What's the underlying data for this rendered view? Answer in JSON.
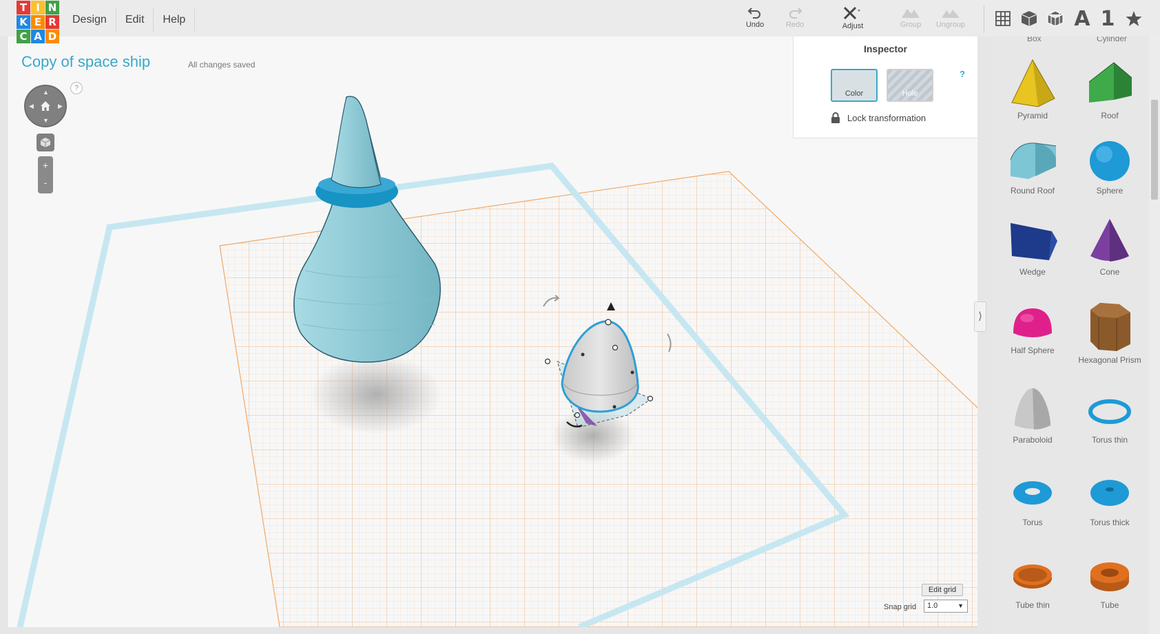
{
  "logo": {
    "letters": [
      "T",
      "I",
      "N",
      "K",
      "E",
      "R",
      "C",
      "A",
      "D"
    ],
    "colors": [
      "#e53935",
      "#fbc02d",
      "#43a047",
      "#1e88e5",
      "#fb8c00",
      "#e53935",
      "#43a047",
      "#1e88e5",
      "#fb8c00"
    ]
  },
  "menu": {
    "items": [
      "Design",
      "Edit",
      "Help"
    ]
  },
  "toolbar": {
    "undo": {
      "label": "Undo",
      "icon": "undo-icon"
    },
    "redo": {
      "label": "Redo",
      "icon": "redo-icon"
    },
    "adjust": {
      "label": "Adjust",
      "icon": "adjust-icon"
    },
    "group": {
      "label": "Group",
      "icon": "group-icon"
    },
    "ungroup": {
      "label": "Ungroup",
      "icon": "ungroup-icon"
    }
  },
  "views": {
    "grid": "grid-view-icon",
    "box": "box-view-icon",
    "wireframe": "wireframe-view-icon",
    "text_label": "A",
    "number_label": "1",
    "star": "star-icon"
  },
  "document": {
    "title": "Copy of space ship",
    "status": "All changes saved"
  },
  "nav": {
    "help": "?",
    "zoom_in": "+",
    "zoom_out": "-"
  },
  "inspector": {
    "title": "Inspector",
    "help": "?",
    "color_label": "Color",
    "hole_label": "Hole",
    "lock_label": "Lock transformation",
    "color_value": "#d9e0e4"
  },
  "grid": {
    "edit_label": "Edit grid",
    "snap_label": "Snap grid",
    "snap_value": "1.0"
  },
  "panel": {
    "cut_left": "Box",
    "cut_right": "Cylinder",
    "collapse": "⟩",
    "shapes": [
      {
        "name": "Pyramid",
        "icon": "pyramid-icon",
        "color": "#e8c520"
      },
      {
        "name": "Roof",
        "icon": "roof-icon",
        "color": "#3faa4a"
      },
      {
        "name": "Round Roof",
        "icon": "round-roof-icon",
        "color": "#7cc6d6"
      },
      {
        "name": "Sphere",
        "icon": "sphere-icon",
        "color": "#1e9ad6"
      },
      {
        "name": "Wedge",
        "icon": "wedge-icon",
        "color": "#1e3a8a"
      },
      {
        "name": "Cone",
        "icon": "cone-icon",
        "color": "#7b3fa0"
      },
      {
        "name": "Half Sphere",
        "icon": "half-sphere-icon",
        "color": "#e0208a"
      },
      {
        "name": "Hexagonal Prism",
        "icon": "hexagonal-prism-icon",
        "color": "#8b5a2b"
      },
      {
        "name": "Paraboloid",
        "icon": "paraboloid-icon",
        "color": "#c8c8c8"
      },
      {
        "name": "Torus thin",
        "icon": "torus-thin-icon",
        "color": "#1e9ad6"
      },
      {
        "name": "Torus",
        "icon": "torus-icon",
        "color": "#1e9ad6"
      },
      {
        "name": "Torus thick",
        "icon": "torus-thick-icon",
        "color": "#1e9ad6"
      },
      {
        "name": "Tube thin",
        "icon": "tube-thin-icon",
        "color": "#e07020"
      },
      {
        "name": "Tube",
        "icon": "tube-icon",
        "color": "#e07020"
      }
    ]
  },
  "colors": {
    "accent": "#3aa8c9",
    "grid": "#f0b98a",
    "workplane_border": "#bfe3ef"
  }
}
